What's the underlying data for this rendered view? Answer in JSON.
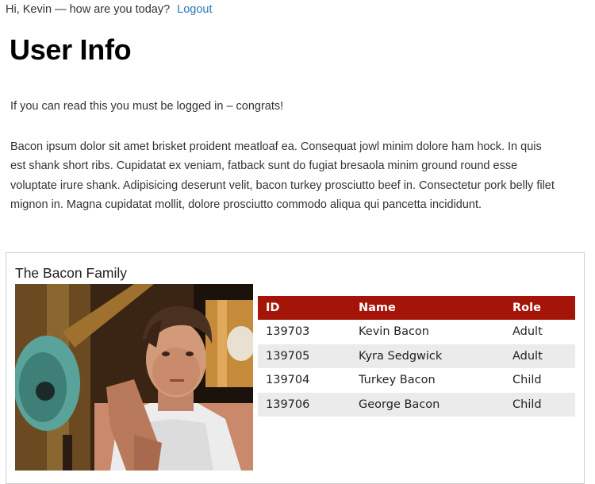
{
  "header": {
    "greeting": "Hi, Kevin — how are you today?",
    "logout_label": "Logout"
  },
  "main": {
    "title": "User Info",
    "logged_in_message": "If you can read this you must be logged in – congrats!",
    "body_text": "Bacon ipsum dolor sit amet brisket proident meatloaf ea. Consequat jowl minim dolore ham hock. In quis est shank short ribs. Cupidatat ex veniam, fatback sunt do fugiat bresaola minim ground round esse voluptate irure shank. Adipisicing deserunt velit, bacon turkey prosciutto beef in. Consectetur pork belly filet mignon in. Magna cupidatat mollit, dolore prosciutto commodo aliqua qui pancetta incididunt."
  },
  "family_panel": {
    "title": "The Bacon Family",
    "table": {
      "headers": [
        "ID",
        "Name",
        "Role"
      ],
      "rows": [
        [
          "139703",
          "Kevin Bacon",
          "Adult"
        ],
        [
          "139705",
          "Kyra Sedgwick",
          "Adult"
        ],
        [
          "139704",
          "Turkey Bacon",
          "Child"
        ],
        [
          "139706",
          "George Bacon",
          "Child"
        ]
      ]
    },
    "header_color": "#a51408",
    "alt_row_color": "#ebebeb"
  },
  "colors": {
    "link": "#2a7ab8"
  }
}
